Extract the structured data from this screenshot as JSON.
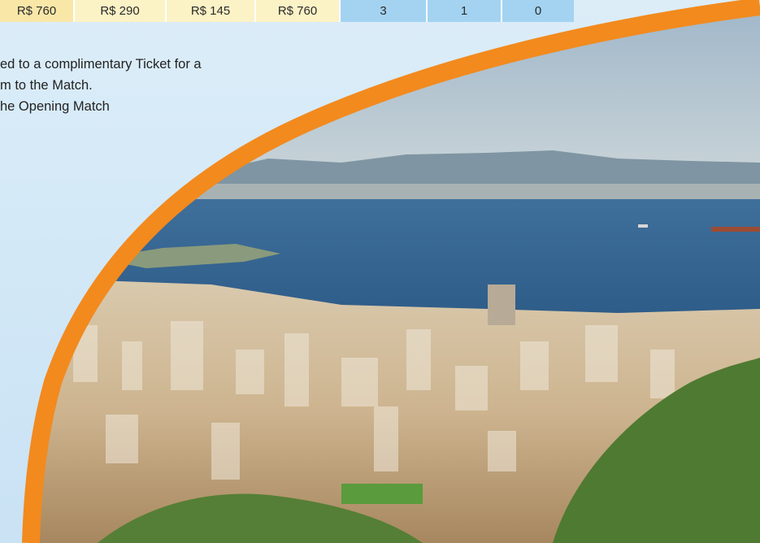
{
  "price_row": {
    "cells": [
      {
        "text": "R$ 760",
        "kind": "price"
      },
      {
        "text": "R$ 290",
        "kind": "price"
      },
      {
        "text": "R$ 145",
        "kind": "price"
      },
      {
        "text": "R$ 760",
        "kind": "price"
      },
      {
        "text": "3",
        "kind": "count"
      },
      {
        "text": "1",
        "kind": "count"
      },
      {
        "text": "0",
        "kind": "count"
      }
    ]
  },
  "notes": {
    "line1": "ed to a complimentary Ticket for a",
    "line2": "m to the Match.",
    "line3": "he Opening Match"
  },
  "colors": {
    "accent_orange": "#f28a1e",
    "price_cell": "#fbf2c6",
    "count_cell": "#a3d3f1",
    "background": "#dcedf8"
  },
  "photo": {
    "icon": "city-bay-photo"
  }
}
